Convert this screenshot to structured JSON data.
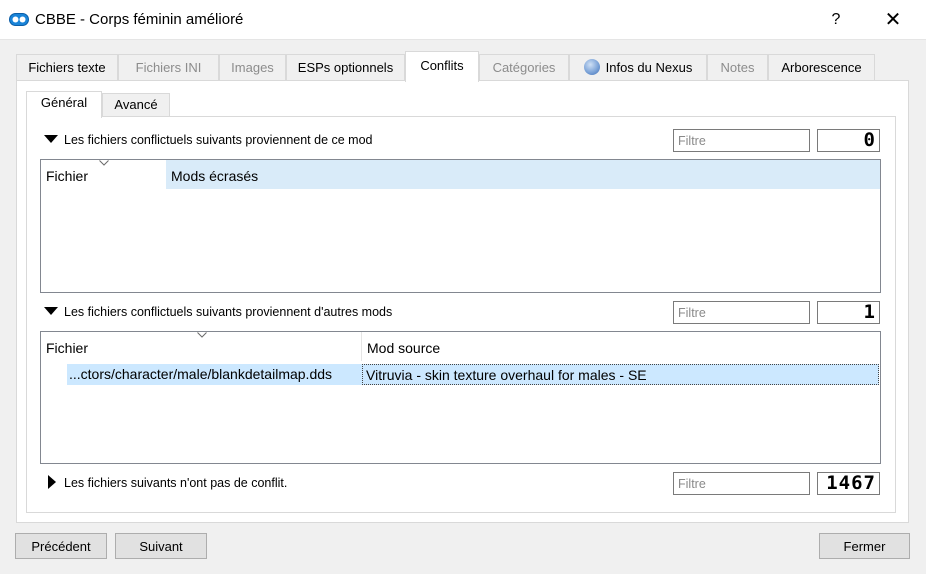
{
  "window": {
    "title": "CBBE - Corps féminin amélioré",
    "help_label": "?",
    "close_label": "✕",
    "icon": "mod-organizer-icon"
  },
  "tabs": [
    {
      "label": "Fichiers texte",
      "enabled": true
    },
    {
      "label": "Fichiers INI",
      "enabled": false
    },
    {
      "label": "Images",
      "enabled": false
    },
    {
      "label": "ESPs optionnels",
      "enabled": true
    },
    {
      "label": "Conflits",
      "enabled": true,
      "active": true
    },
    {
      "label": "Catégories",
      "enabled": false
    },
    {
      "label": "Infos du Nexus",
      "enabled": true,
      "icon": "globe-icon"
    },
    {
      "label": "Notes",
      "enabled": false
    },
    {
      "label": "Arborescence",
      "enabled": true
    }
  ],
  "subtabs": [
    {
      "label": "Général",
      "active": true
    },
    {
      "label": "Avancé",
      "active": false
    }
  ],
  "sections": {
    "overwrite": {
      "label": "Les fichiers conflictuels suivants proviennent de ce mod",
      "filter_placeholder": "Filtre",
      "count": "0",
      "columns": [
        "Fichier",
        "Mods écrasés"
      ],
      "rows": []
    },
    "overwritten": {
      "label": "Les fichiers conflictuels suivants proviennent d'autres mods",
      "filter_placeholder": "Filtre",
      "count": "1",
      "columns": [
        "Fichier",
        "Mod source"
      ],
      "rows": [
        {
          "file": "...ctors/character/male/blankdetailmap.dds",
          "source": "Vitruvia - skin texture overhaul for males - SE"
        }
      ]
    },
    "noconflict": {
      "label": "Les fichiers suivants n'ont pas de conflit.",
      "filter_placeholder": "Filtre",
      "count": "1467"
    }
  },
  "buttons": {
    "previous": "Précédent",
    "next": "Suivant",
    "close": "Fermer"
  },
  "colors": {
    "selection": "#cce8ff",
    "header_highlight": "#d9ebf9",
    "app_icon": "#1a84d8"
  }
}
